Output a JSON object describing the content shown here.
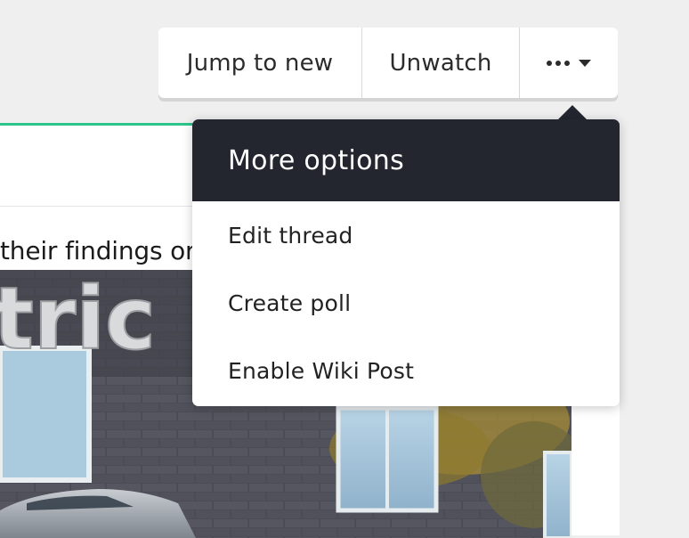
{
  "toolbar": {
    "jump_label": "Jump to new",
    "unwatch_label": "Unwatch",
    "more_icon": "ellipsis-icon",
    "caret_icon": "caret-down-icon"
  },
  "menu": {
    "title": "More options",
    "items": [
      {
        "label": "Edit thread"
      },
      {
        "label": "Create poll"
      },
      {
        "label": "Enable Wiki Post"
      }
    ]
  },
  "post": {
    "text_fragment": "their findings or g",
    "image_sign_text": "tric",
    "accent_color": "#2bc48a"
  },
  "colors": {
    "menu_header_bg": "#23262f",
    "background": "#efefef"
  }
}
